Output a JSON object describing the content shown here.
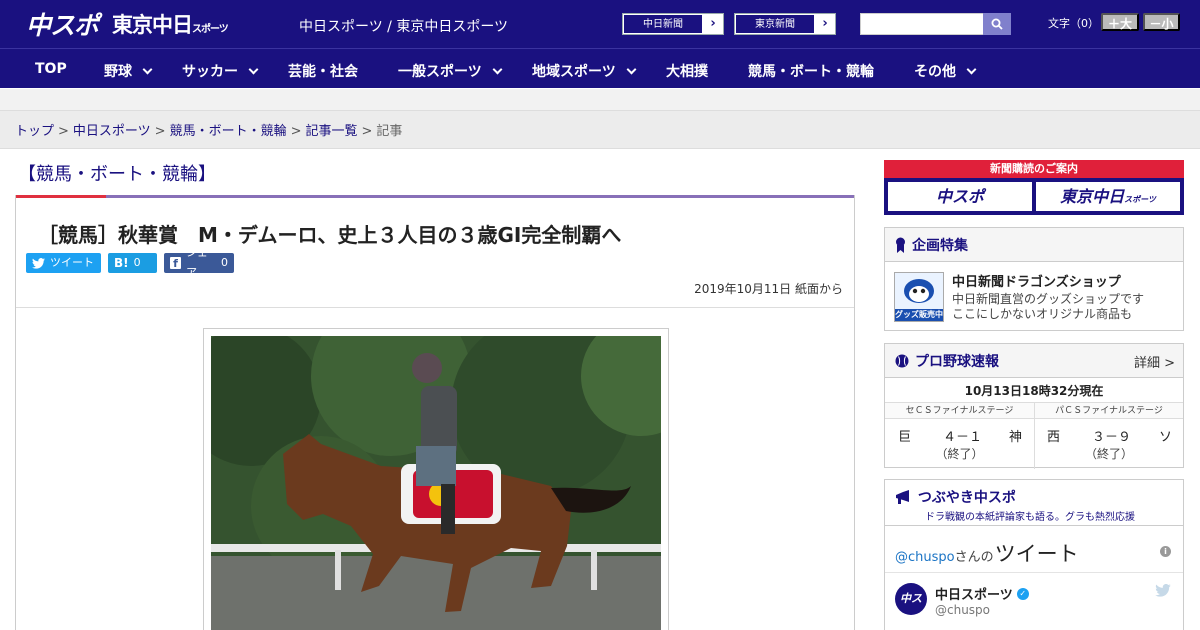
{
  "header": {
    "logo_chuspo": "中スポ",
    "logo_tokyo": "東京中日",
    "logo_tokyo_small": "スポーツ",
    "site_name": "中日スポーツ / 東京中日スポーツ",
    "paper_buttons": [
      {
        "label": "中日新聞",
        "arrow": "›"
      },
      {
        "label": "東京新聞",
        "arrow": "›"
      }
    ],
    "search_placeholder": "",
    "font_size_label": "文字（0）",
    "font_larger": "＋大",
    "font_smaller": "－小",
    "colors": {
      "brand": "#1a1180",
      "accent": "#e0303f"
    }
  },
  "nav": {
    "items": [
      {
        "label": "TOP",
        "dropdown": false
      },
      {
        "label": "野球",
        "dropdown": true
      },
      {
        "label": "サッカー",
        "dropdown": true
      },
      {
        "label": "芸能・社会",
        "dropdown": false
      },
      {
        "label": "一般スポーツ",
        "dropdown": true
      },
      {
        "label": "地域スポーツ",
        "dropdown": true
      },
      {
        "label": "大相撲",
        "dropdown": false
      },
      {
        "label": "競馬・ボート・競輪",
        "dropdown": false
      },
      {
        "label": "その他",
        "dropdown": true
      }
    ]
  },
  "breadcrumb": {
    "items": [
      "トップ",
      "中日スポーツ",
      "競馬・ボート・競輪",
      "記事一覧"
    ],
    "separator": ">",
    "current": "記事"
  },
  "article": {
    "category_title": "【競馬・ボート・競輪】",
    "headline": "［競馬］秋華賞　M・デムーロ、史上３人目の３歳GI完全制覇へ",
    "share": {
      "tweet_label": "ツイート",
      "hatena_icon": "B!",
      "hatena_count": "0",
      "facebook_label": "シェア",
      "facebook_count": "0"
    },
    "date": "2019年10月11日 紙面から"
  },
  "sidebar": {
    "subscription": {
      "title": "新聞購読のご案内",
      "left": "中スポ",
      "right": "東京中日",
      "right_small": "スポーツ"
    },
    "feature": {
      "title": "企画特集",
      "shop_title": "中日新聞ドラゴンズショップ",
      "shop_desc_1": "中日新聞直営のグッズショップです",
      "shop_desc_2": "ここにしかないオリジナル商品も",
      "shop_badge": "グッズ販売中"
    },
    "baseball": {
      "title": "プロ野球速報",
      "more": "詳細 >",
      "time": "10月13日18時32分現在",
      "games": [
        {
          "stage": "セＣＳファイナルステージ",
          "home": "巨",
          "score": "４－１",
          "away": "神",
          "status": "（終了）"
        },
        {
          "stage": "パＣＳファイナルステージ",
          "home": "西",
          "score": "３－９",
          "away": "ソ",
          "status": "（終了）"
        }
      ]
    },
    "twitter": {
      "title": "つぶやき中スポ",
      "subtitle": "ドラ戦観の本紙評論家も語る。グラも熱烈応援",
      "handle_line": "@chuspo",
      "san_no": "さんの",
      "tweet_word": "ツイート",
      "account_name": "中日スポーツ",
      "account_handle": "@chuspo",
      "avatar_text": "中スポ"
    }
  }
}
